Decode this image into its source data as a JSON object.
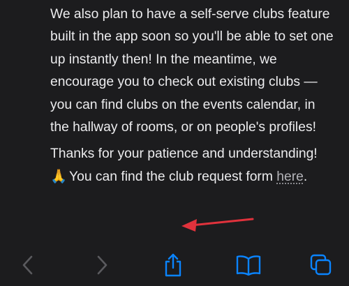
{
  "article": {
    "paragraph1": "We also plan to have a self-serve clubs feature built in the app soon so you'll be able to set one up instantly then! In the meantime, we encourage you to check out existing clubs — you can find clubs on the events calendar, in the hallway of rooms, or on people's profiles!",
    "paragraph2_before": "Thanks for your patience and understanding! ",
    "paragraph2_emoji": "🙏",
    "paragraph2_middle": " You can find the club request form ",
    "link_text": "here",
    "paragraph2_after": "."
  },
  "annotation": {
    "arrow_color": "#e0323c"
  },
  "toolbar": {
    "icons": [
      "back-icon",
      "forward-icon",
      "share-icon",
      "bookmarks-icon",
      "tabs-icon"
    ],
    "accent_color": "#0a84ff",
    "disabled_color": "#5a5a5e"
  }
}
